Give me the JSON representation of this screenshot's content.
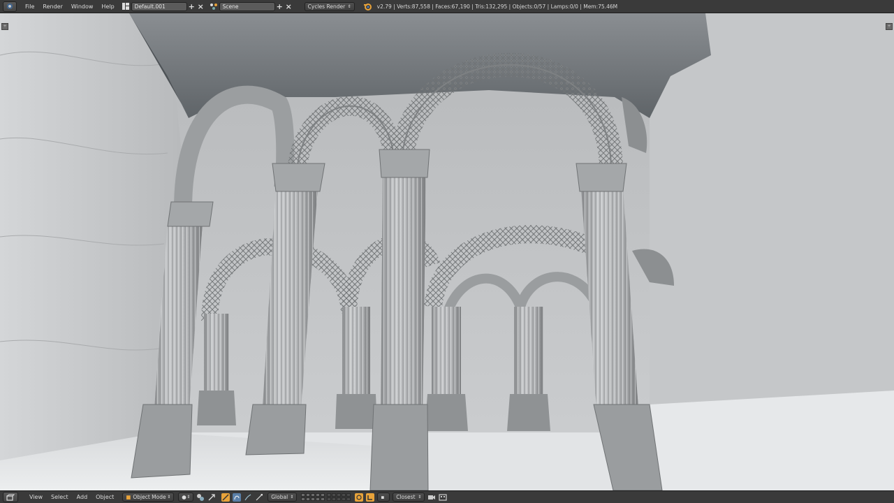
{
  "header": {
    "menu": [
      "File",
      "Render",
      "Window",
      "Help"
    ],
    "screen_layout": "Default.001",
    "scene": "Scene",
    "render_engine": "Cycles Render",
    "stats": "v2.79 | Verts:87,558 | Faces:67,190 | Tris:132,295 | Objects:0/57 | Lamps:0/0 | Mem:75.46M"
  },
  "footer": {
    "menu": [
      "View",
      "Select",
      "Add",
      "Object"
    ],
    "mode": "Object Mode",
    "orientation": "Global",
    "snap_target": "Closest"
  },
  "colors": {
    "accent": "#e8a33a",
    "header_bg": "#3a3a3a",
    "field_bg": "#5b5b5b"
  },
  "icons": {
    "editor_type": "info-editor-icon",
    "layout": "screen-layout-icon",
    "scene": "scene-icon",
    "blender": "blender-logo-icon",
    "viewport_editor": "3d-view-icon",
    "mode": "object-mode-icon",
    "shading": "solid-shading-icon"
  }
}
